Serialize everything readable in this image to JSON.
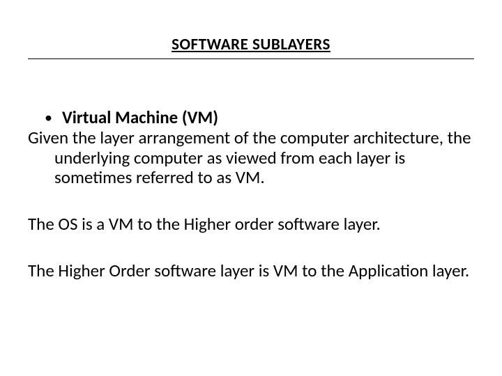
{
  "title": "SOFTWARE SUBLAYERS",
  "bullet1_label": "Virtual Machine  (VM)",
  "para1": "Given the layer arrangement of the computer architecture, the underlying computer  as viewed from each layer is sometimes referred to as VM.",
  "para2": "The OS is a VM to the Higher order software layer.",
  "para3": "The Higher Order software layer is VM to the Application layer."
}
